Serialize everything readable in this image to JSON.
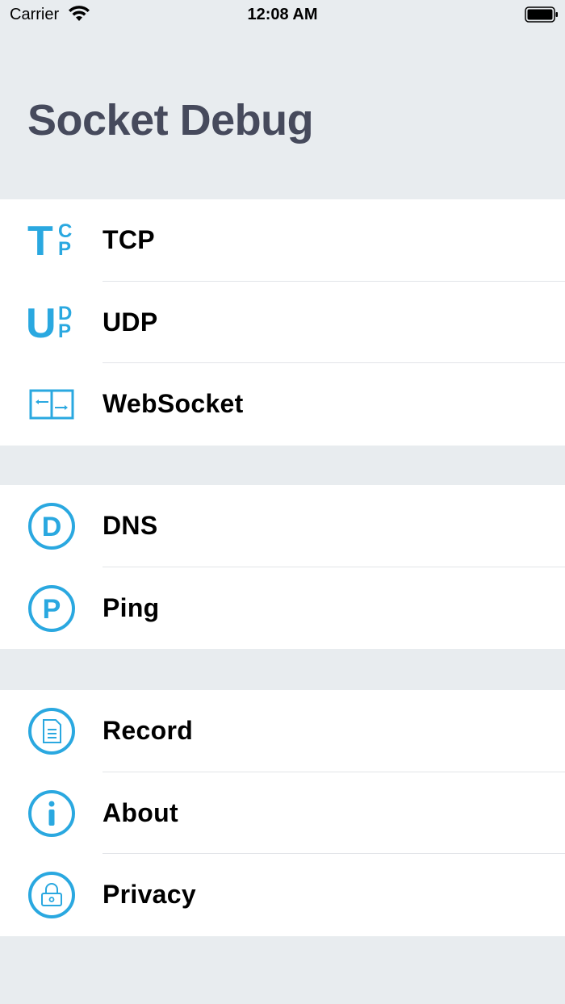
{
  "status_bar": {
    "carrier": "Carrier",
    "time": "12:08 AM"
  },
  "header": {
    "title": "Socket Debug"
  },
  "accent_color": "#2aa8e0",
  "groups": [
    {
      "items": [
        {
          "label": "TCP",
          "icon": "tcp-icon"
        },
        {
          "label": "UDP",
          "icon": "udp-icon"
        },
        {
          "label": "WebSocket",
          "icon": "websocket-icon"
        }
      ]
    },
    {
      "items": [
        {
          "label": "DNS",
          "icon": "dns-icon"
        },
        {
          "label": "Ping",
          "icon": "ping-icon"
        }
      ]
    },
    {
      "items": [
        {
          "label": "Record",
          "icon": "document-icon"
        },
        {
          "label": "About",
          "icon": "info-icon"
        },
        {
          "label": "Privacy",
          "icon": "lock-icon"
        }
      ]
    }
  ]
}
